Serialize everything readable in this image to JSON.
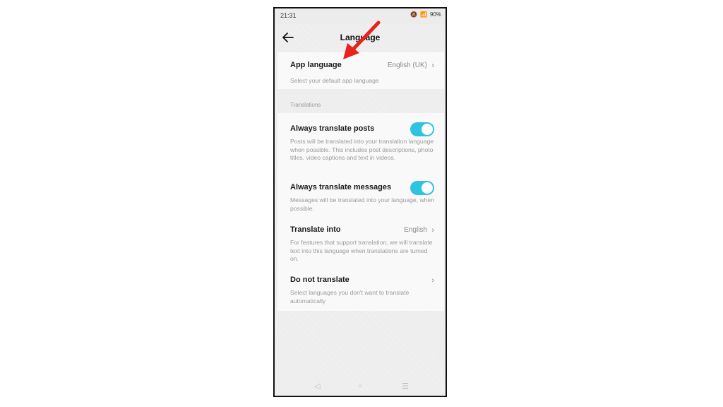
{
  "status": {
    "time": "21:31",
    "battery": "90%"
  },
  "header": {
    "title": "Language"
  },
  "app_language": {
    "title": "App language",
    "value": "English (UK)",
    "description": "Select your default app language"
  },
  "translations": {
    "section_label": "Translations",
    "always_posts": {
      "title": "Always translate posts",
      "description": "Posts will be translated into your translation language when possible. This includes post descriptions, photo titles, video captions and text in videos.",
      "enabled": true
    },
    "always_messages": {
      "title": "Always translate messages",
      "description": "Messages will be translated into your language, when possible.",
      "enabled": true
    },
    "translate_into": {
      "title": "Translate into",
      "value": "English",
      "description": "For features that support translation, we will translate text into this language when translations are turned on."
    },
    "do_not_translate": {
      "title": "Do not translate",
      "description": "Select languages you don't want to translate automatically"
    }
  },
  "colors": {
    "toggle_on": "#2ec4e0",
    "arrow": "#e8231c"
  },
  "icons": {
    "back": "arrow-left-icon",
    "chevron": "chevron-right-icon"
  }
}
